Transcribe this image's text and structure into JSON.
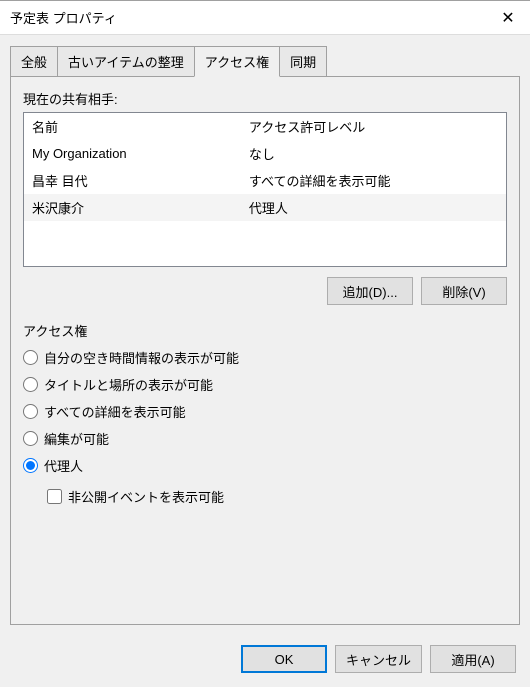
{
  "window": {
    "title": "予定表 プロパティ"
  },
  "tabs": [
    {
      "label": "全般"
    },
    {
      "label": "古いアイテムの整理"
    },
    {
      "label": "アクセス権"
    },
    {
      "label": "同期"
    }
  ],
  "active_tab": 2,
  "sharing": {
    "label": "現在の共有相手:",
    "columns": {
      "name": "名前",
      "level": "アクセス許可レベル"
    },
    "rows": [
      {
        "name": "My Organization",
        "level": "なし"
      },
      {
        "name": "昌幸 目代",
        "level": "すべての詳細を表示可能"
      },
      {
        "name": "米沢康介",
        "level": "代理人"
      }
    ],
    "selected": 2,
    "add": "追加(D)...",
    "remove": "削除(V)"
  },
  "perm": {
    "label": "アクセス権",
    "options": [
      {
        "label": "自分の空き時間情報の表示が可能"
      },
      {
        "label": "タイトルと場所の表示が可能"
      },
      {
        "label": "すべての詳細を表示可能"
      },
      {
        "label": "編集が可能"
      },
      {
        "label": "代理人"
      }
    ],
    "selected": 4,
    "private_checkbox": "非公開イベントを表示可能",
    "private_checked": false
  },
  "buttons": {
    "ok": "OK",
    "cancel": "キャンセル",
    "apply": "適用(A)"
  }
}
